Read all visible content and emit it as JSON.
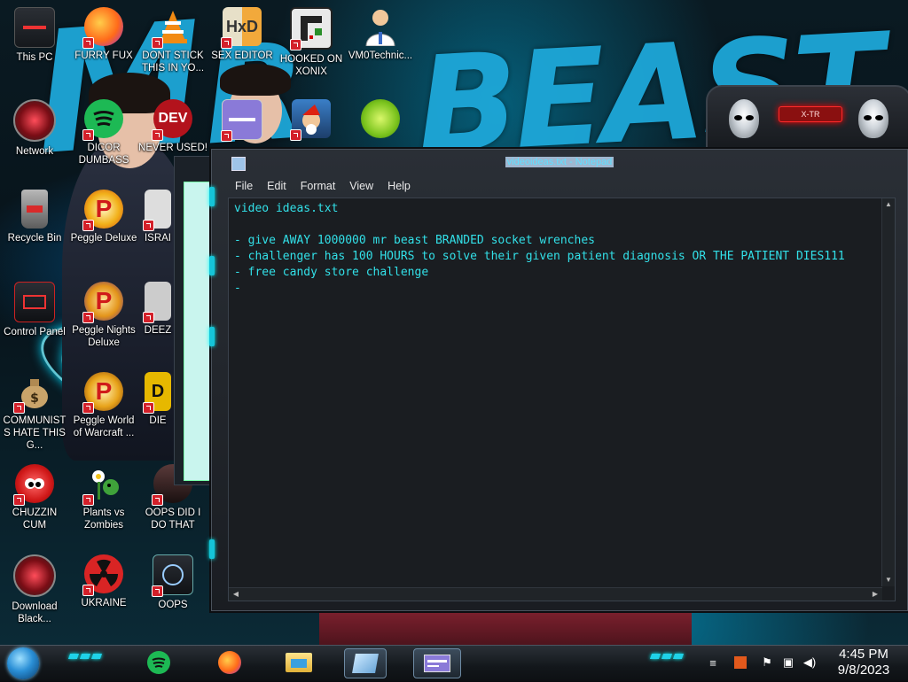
{
  "desktop": {
    "icons": [
      {
        "label": "This PC"
      },
      {
        "label": "FURRY FUX"
      },
      {
        "label": "DONT STICK THIS IN YO..."
      },
      {
        "label": "SEX EDITOR"
      },
      {
        "label": "HOOKED ON XONIX"
      },
      {
        "label": "VM0Technic..."
      },
      {
        "label": "Network"
      },
      {
        "label": "DICOR DUMBASS"
      },
      {
        "label": "NEVER USED!"
      },
      {
        "label": "Recycle Bin"
      },
      {
        "label": "Peggle Deluxe"
      },
      {
        "label": "ISRAI"
      },
      {
        "label": "Control Panel"
      },
      {
        "label": "Peggle Nights Deluxe"
      },
      {
        "label": "DEEZ"
      },
      {
        "label": "COMMUNISTS HATE THIS G..."
      },
      {
        "label": "Peggle World of Warcraft ..."
      },
      {
        "label": "DIE"
      },
      {
        "label": "CHUZZIN CUM"
      },
      {
        "label": "Plants vs Zombies"
      },
      {
        "label": "OOPS DID I DO THAT"
      },
      {
        "label": "Download Black..."
      },
      {
        "label": "UKRAINE"
      },
      {
        "label": "OOPS"
      }
    ],
    "dev_icon_text": "DEV",
    "alien_widget_text": "X-TR"
  },
  "notepad": {
    "title": "videoideas.txt - Notepad",
    "menu": [
      "File",
      "Edit",
      "Format",
      "View",
      "Help"
    ],
    "content": "video ideas.txt\n\n- give AWAY 1000000 mr beast BRANDED socket wrenches\n- challenger has 100 HOURS to solve their given patient diagnosis OR THE PATIENT DIES111\n- free candy store challenge\n-"
  },
  "taskbar": {
    "clock_time": "4:45 PM",
    "clock_date": "9/8/2023"
  },
  "colors": {
    "accent": "#1fd2e8",
    "notepad_text": "#32e0e8",
    "wall_text": "#1ea7d8"
  }
}
